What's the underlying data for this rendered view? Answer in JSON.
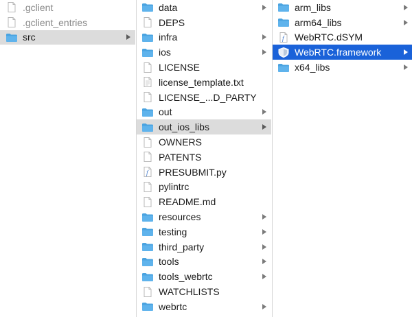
{
  "columns": [
    {
      "items": [
        {
          "label": ".gclient",
          "icon": "document-icon",
          "dim": true,
          "folder": false
        },
        {
          "label": ".gclient_entries",
          "icon": "document-icon",
          "dim": true,
          "folder": false
        },
        {
          "label": "src",
          "icon": "folder-icon",
          "folder": true,
          "state": "highlight"
        }
      ]
    },
    {
      "items": [
        {
          "label": "data",
          "icon": "folder-icon",
          "folder": true
        },
        {
          "label": "DEPS",
          "icon": "document-icon",
          "folder": false
        },
        {
          "label": "infra",
          "icon": "folder-icon",
          "folder": true
        },
        {
          "label": "ios",
          "icon": "folder-icon",
          "folder": true
        },
        {
          "label": "LICENSE",
          "icon": "document-icon",
          "folder": false
        },
        {
          "label": "license_template.txt",
          "icon": "text-document-icon",
          "folder": false
        },
        {
          "label": "LICENSE_...D_PARTY",
          "icon": "document-icon",
          "folder": false
        },
        {
          "label": "out",
          "icon": "folder-icon",
          "folder": true
        },
        {
          "label": "out_ios_libs",
          "icon": "folder-icon",
          "folder": true,
          "state": "highlight"
        },
        {
          "label": "OWNERS",
          "icon": "document-icon",
          "folder": false
        },
        {
          "label": "PATENTS",
          "icon": "document-icon",
          "folder": false
        },
        {
          "label": "PRESUBMIT.py",
          "icon": "python-file-icon",
          "folder": false
        },
        {
          "label": "pylintrc",
          "icon": "document-icon",
          "folder": false
        },
        {
          "label": "README.md",
          "icon": "document-icon",
          "folder": false
        },
        {
          "label": "resources",
          "icon": "folder-icon",
          "folder": true
        },
        {
          "label": "testing",
          "icon": "folder-icon",
          "folder": true
        },
        {
          "label": "third_party",
          "icon": "folder-icon",
          "folder": true
        },
        {
          "label": "tools",
          "icon": "folder-icon",
          "folder": true
        },
        {
          "label": "tools_webrtc",
          "icon": "folder-icon",
          "folder": true
        },
        {
          "label": "WATCHLISTS",
          "icon": "document-icon",
          "folder": false
        },
        {
          "label": "webrtc",
          "icon": "folder-icon",
          "folder": true
        }
      ]
    },
    {
      "items": [
        {
          "label": "arm_libs",
          "icon": "folder-icon",
          "folder": true
        },
        {
          "label": "arm64_libs",
          "icon": "folder-icon",
          "folder": true
        },
        {
          "label": "WebRTC.dSYM",
          "icon": "dsym-file-icon",
          "folder": false
        },
        {
          "label": "WebRTC.framework",
          "icon": "framework-icon",
          "folder": true,
          "state": "selected"
        },
        {
          "label": "x64_libs",
          "icon": "folder-icon",
          "folder": true
        }
      ]
    }
  ],
  "colors": {
    "folder": "#5fb3ec",
    "folder_tab": "#4aa3e0",
    "selection": "#1a62d9",
    "highlight": "#dcdcdc",
    "chevron": "#7a7a7a"
  }
}
